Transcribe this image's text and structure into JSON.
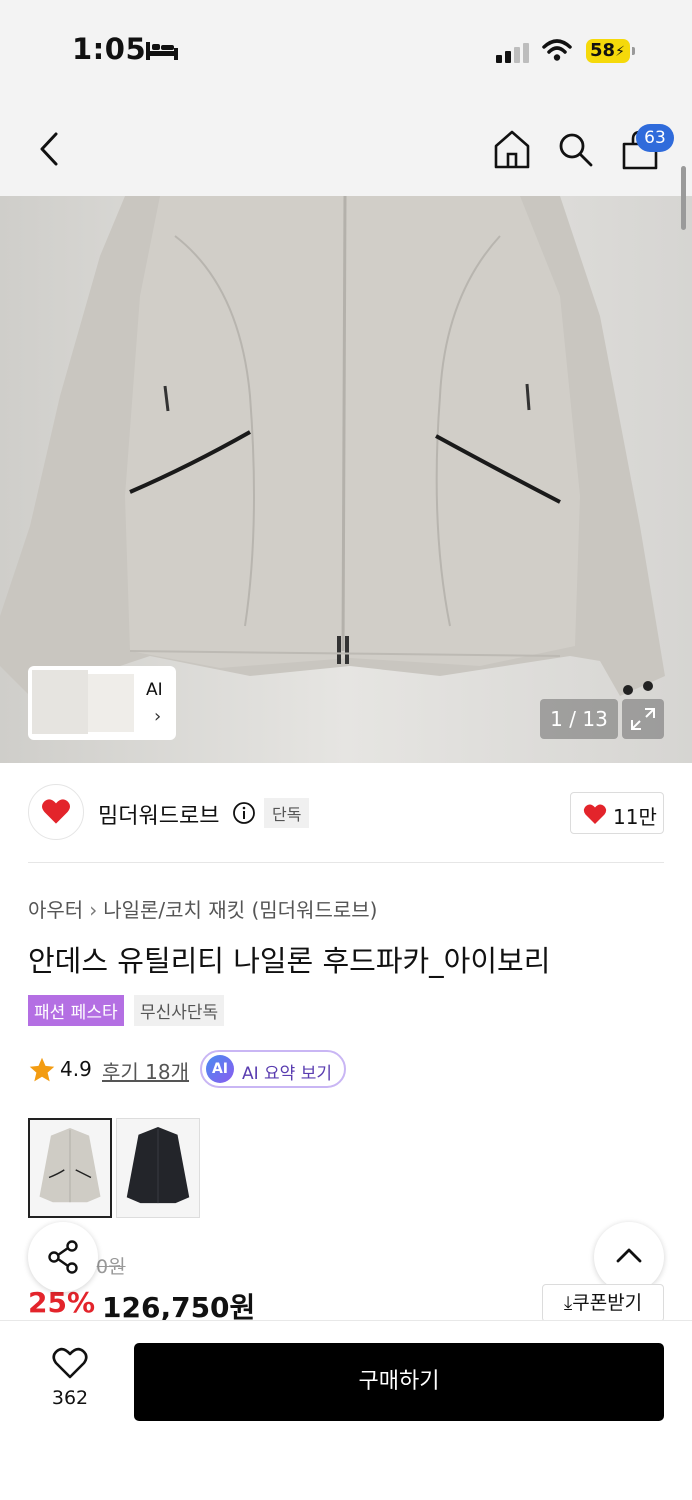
{
  "status_bar": {
    "time": "1:05",
    "battery": "58"
  },
  "header": {
    "cart_count": "63",
    "icons": [
      "back-icon",
      "home-icon",
      "search-icon",
      "cart-icon"
    ]
  },
  "gallery": {
    "ai_label": "AI",
    "counter": "1 / 13"
  },
  "brand": {
    "name": "밈더워드로브",
    "exclusive": "단독",
    "likes": "11만"
  },
  "breadcrumb": [
    "아우터",
    "나일론/코치 재킷 (밈더워드로브)"
  ],
  "product": {
    "title": "안데스 유틸리티 나일론 후드파카_아이보리",
    "tags": [
      "패션 페스타",
      "무신사단독"
    ],
    "rating": "4.9",
    "reviews": "후기 18개",
    "ai_summary_badge": "AI",
    "ai_summary": "AI 요약 보기",
    "original_price": "0원",
    "discount": "25%",
    "price": "126,750원",
    "coupon": "쿠폰받기"
  },
  "bottom": {
    "wish_count": "362",
    "buy_label": "구매하기"
  },
  "colors": {
    "accent_blue": "#2f6bdb",
    "discount_red": "#e3242b",
    "tag_purple": "#b46fe3"
  }
}
